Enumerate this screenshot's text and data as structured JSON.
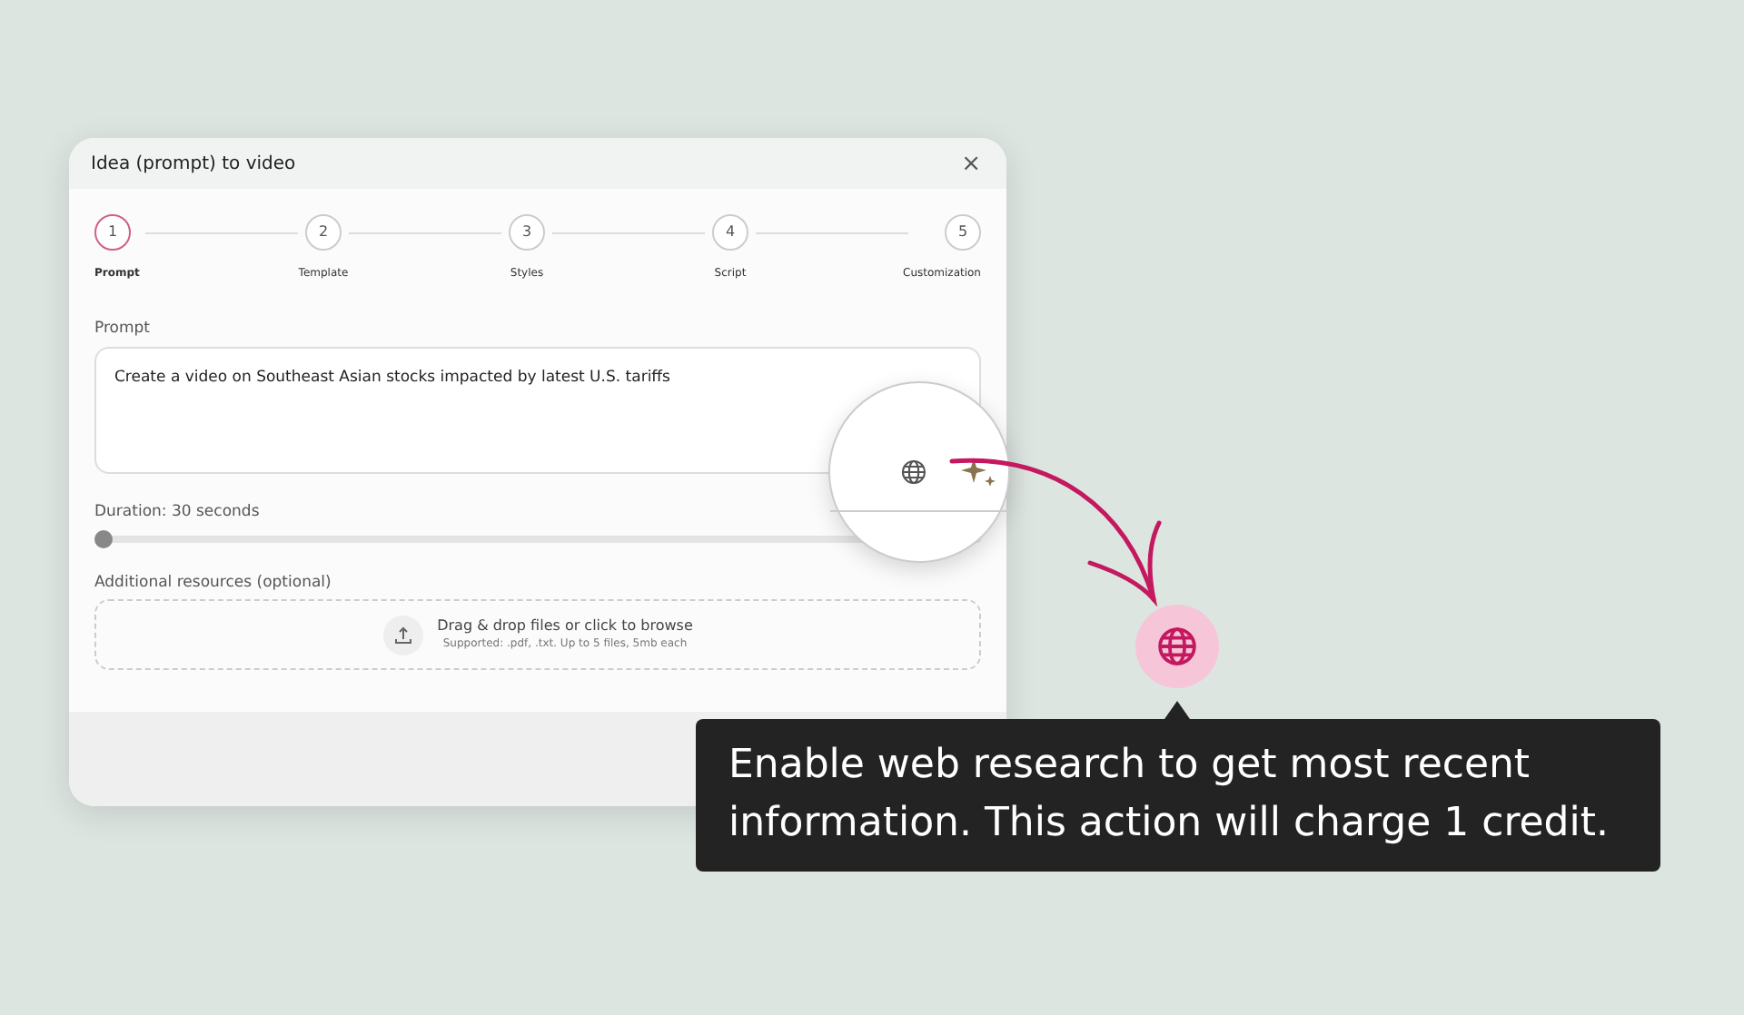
{
  "dialog": {
    "title": "Idea (prompt) to video",
    "close": "×",
    "steps": [
      {
        "number": "1",
        "label": "Prompt",
        "selected": true
      },
      {
        "number": "2",
        "label": "Template",
        "selected": false
      },
      {
        "number": "3",
        "label": "Styles",
        "selected": false
      },
      {
        "number": "4",
        "label": "Script",
        "selected": false
      },
      {
        "number": "5",
        "label": "Customization",
        "selected": false
      }
    ],
    "prompt": {
      "label": "Prompt",
      "value": "Create a video on Southeast Asian stocks impacted by latest U.S. tariffs"
    },
    "duration": {
      "label": "Duration: 30 seconds",
      "level": 0
    },
    "resources": {
      "label": "Additional resources (optional)",
      "title": "Drag & drop files or click to browse",
      "hint": "Supported: .pdf, .txt. Up to 5 files, 5mb each"
    }
  },
  "tooltip": {
    "text": "Enable web research to get most recent information. This action will charge 1 credit."
  }
}
